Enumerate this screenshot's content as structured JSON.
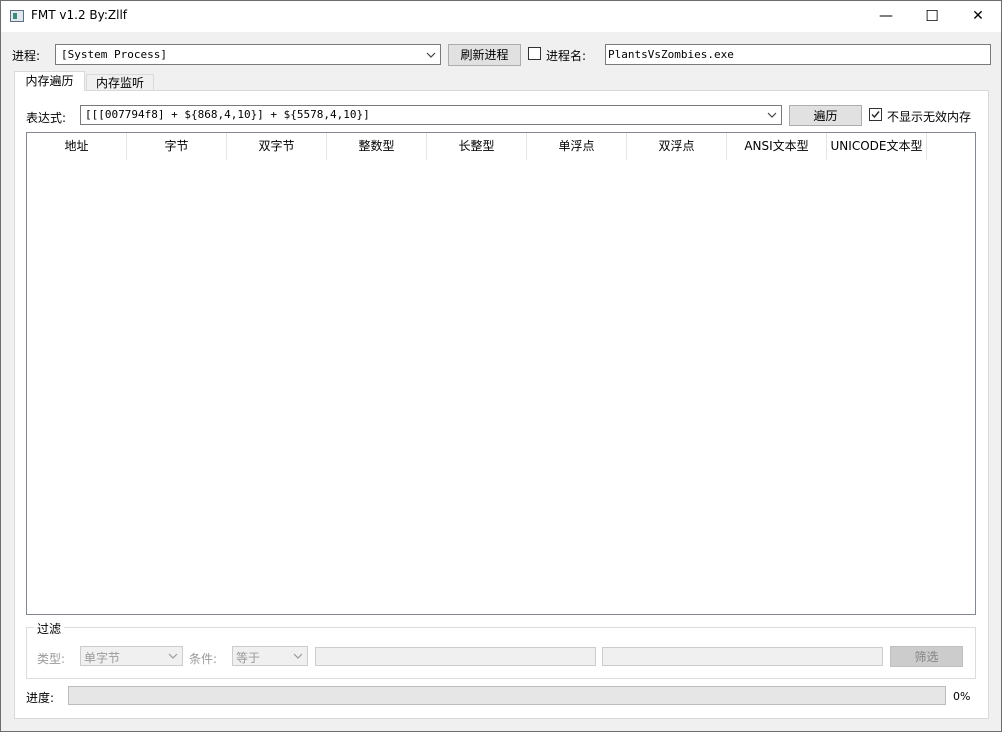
{
  "window": {
    "title": "FMT v1.2 By:Zllf",
    "minimize_glyph": "—",
    "maximize_glyph": "☐",
    "close_glyph": "✕"
  },
  "process": {
    "label": "进程:",
    "selected": "[System Process]",
    "refresh_button": "刷新进程",
    "name_checkbox_label": "进程名:",
    "name_checked": false,
    "name_value": "PlantsVsZombies.exe"
  },
  "tabs": [
    {
      "label": "内存遍历",
      "active": true
    },
    {
      "label": "内存监听",
      "active": false
    }
  ],
  "expression": {
    "label": "表达式:",
    "value": "[[[007794f8] + ${868,4,10}] + ${5578,4,10}]",
    "traverse_button": "遍历",
    "hide_invalid_label": "不显示无效内存",
    "hide_invalid_checked": true
  },
  "table": {
    "columns": [
      "地址",
      "字节",
      "双字节",
      "整数型",
      "长整型",
      "单浮点",
      "双浮点",
      "ANSI文本型",
      "UNICODE文本型"
    ],
    "rows": []
  },
  "filter": {
    "title": "过滤",
    "type_label": "类型:",
    "type_value": "单字节",
    "condition_label": "条件:",
    "condition_value": "等于",
    "value1": "",
    "value2": "",
    "filter_button": "筛选",
    "enabled": false
  },
  "progress": {
    "label": "进度:",
    "percent_text": "0%",
    "value": 0
  },
  "icons": {
    "app": "app-icon",
    "dropdown": "chevron-down-icon",
    "check": "checkmark-icon"
  }
}
